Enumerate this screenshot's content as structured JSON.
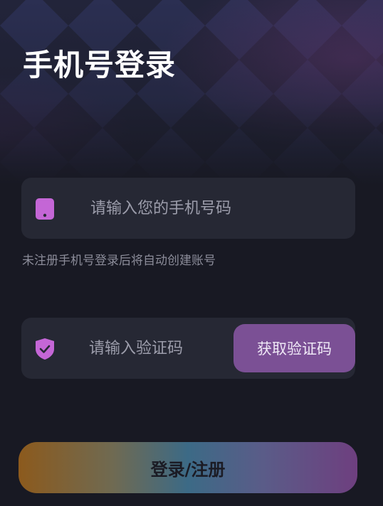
{
  "page": {
    "title": "手机号登录"
  },
  "phone": {
    "icon": "phone-icon",
    "placeholder": "请输入您的手机号码",
    "value": "",
    "hint": "未注册手机号登录后将自动创建账号"
  },
  "code": {
    "icon": "shield-check-icon",
    "placeholder": "请输入验证码",
    "value": "",
    "get_code_label": "获取验证码"
  },
  "submit": {
    "label": "登录/注册"
  },
  "colors": {
    "background": "#181923",
    "field_bg": "#262834",
    "accent": "#7b5095",
    "icon": "#c466d6"
  }
}
